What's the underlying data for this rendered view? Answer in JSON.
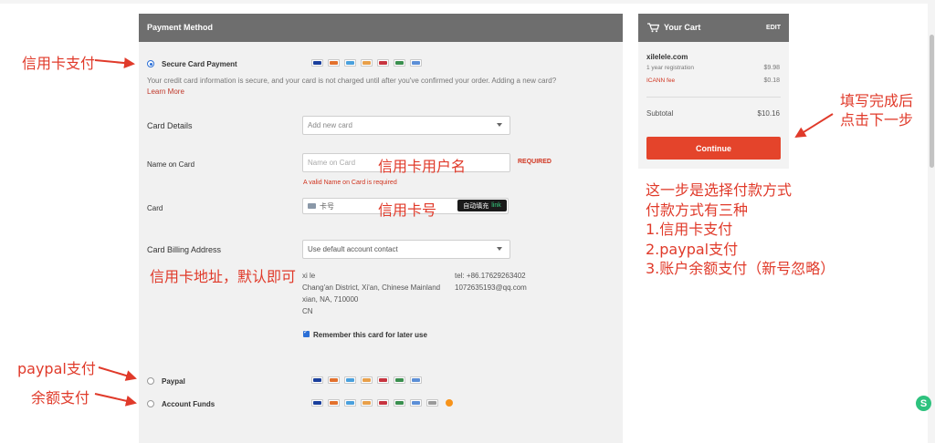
{
  "payment": {
    "header": "Payment Method",
    "secure_label": "Secure Card Payment",
    "secure_note": "Your credit card information is secure, and your card is not charged until after you've confirmed your order. Adding a new card?",
    "learn_more": "Learn More",
    "card_details_label": "Card Details",
    "card_details_value": "Add new card",
    "name_label": "Name on Card",
    "name_placeholder": "Name on Card",
    "required": "REQUIRED",
    "name_error": "A valid Name on Card is required",
    "card_label": "Card",
    "card_placeholder": "卡号",
    "autofill_label": "自动填充",
    "autofill_link": "link",
    "billing_label": "Card Billing Address",
    "billing_value": "Use default account contact",
    "address": {
      "name": "xi le",
      "street": "Chang'an District, Xi'an, Chinese Mainland",
      "city": "xian, NA, 710000",
      "country": "CN",
      "phone": "tel: +86.17629263402",
      "email": "1072635193@qq.com"
    },
    "remember_label": "Remember this card for later use",
    "paypal_label": "Paypal",
    "funds_label": "Account Funds"
  },
  "cart": {
    "title": "Your Cart",
    "edit": "EDIT",
    "domain": "xilelele.com",
    "reg_label": "1 year registration",
    "reg_price": "$9.98",
    "icann_label": "ICANN fee",
    "icann_price": "$0.18",
    "subtotal_label": "Subtotal",
    "subtotal_value": "$10.16",
    "continue_label": "Continue"
  },
  "annotations": {
    "credit_card": "信用卡支付",
    "cardholder": "信用卡用户名",
    "card_number": "信用卡号",
    "billing": "信用卡地址，默认即可",
    "paypal": "paypal支付",
    "funds": "余额支付",
    "next_1": "填写完成后",
    "next_2": "点击下一步",
    "info_1": "这一步是选择付款方式",
    "info_2": "付款方式有三种",
    "info_3": "1.信用卡支付",
    "info_4": "2.paypal支付",
    "info_5": "3.账户余额支付（新号忽略）"
  },
  "colors": {
    "header_bg": "#6e6e6e",
    "accent_red": "#e4442b",
    "annotation_red": "#e03a2a",
    "link_red": "#c0392b"
  }
}
